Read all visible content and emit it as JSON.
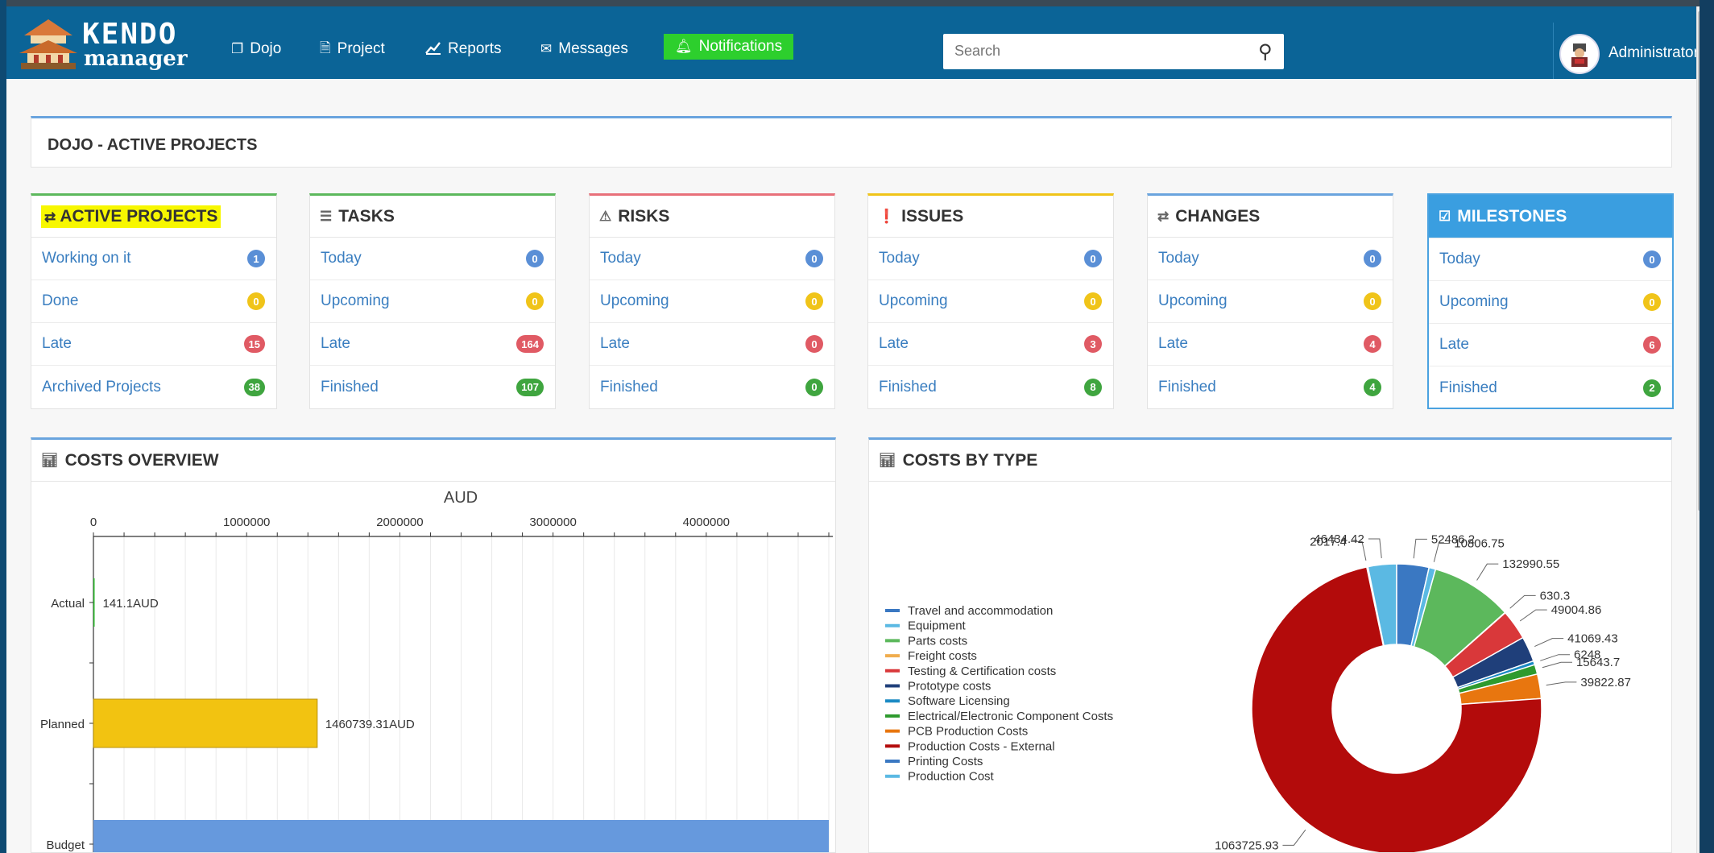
{
  "app": {
    "logo_top": "KENDO",
    "logo_bottom": "manager"
  },
  "nav": {
    "items": [
      {
        "label": "Dojo",
        "icon": "copy-icon"
      },
      {
        "label": "Project",
        "icon": "document-icon"
      },
      {
        "label": "Reports",
        "icon": "line-chart-icon"
      },
      {
        "label": "Messages",
        "icon": "envelope-icon"
      },
      {
        "label": "Notifications",
        "icon": "bell-icon"
      }
    ],
    "search_placeholder": "Search",
    "user": "Administrator"
  },
  "page_title": "DOJO - ACTIVE PROJECTS",
  "cards": [
    {
      "title": "ACTIVE PROJECTS",
      "icon": "exchange-icon",
      "rows": [
        {
          "label": "Working on it",
          "count": "1"
        },
        {
          "label": "Done",
          "count": "0"
        },
        {
          "label": "Late",
          "count": "15"
        },
        {
          "label": "Archived Projects",
          "count": "38"
        }
      ]
    },
    {
      "title": "TASKS",
      "icon": "tasks-icon",
      "rows": [
        {
          "label": "Today",
          "count": "0"
        },
        {
          "label": "Upcoming",
          "count": "0"
        },
        {
          "label": "Late",
          "count": "164"
        },
        {
          "label": "Finished",
          "count": "107"
        }
      ]
    },
    {
      "title": "RISKS",
      "icon": "warning-icon",
      "rows": [
        {
          "label": "Today",
          "count": "0"
        },
        {
          "label": "Upcoming",
          "count": "0"
        },
        {
          "label": "Late",
          "count": "0"
        },
        {
          "label": "Finished",
          "count": "0"
        }
      ]
    },
    {
      "title": "ISSUES",
      "icon": "exclamation-circle-icon",
      "rows": [
        {
          "label": "Today",
          "count": "0"
        },
        {
          "label": "Upcoming",
          "count": "0"
        },
        {
          "label": "Late",
          "count": "3"
        },
        {
          "label": "Finished",
          "count": "8"
        }
      ]
    },
    {
      "title": "CHANGES",
      "icon": "exchange-icon",
      "rows": [
        {
          "label": "Today",
          "count": "0"
        },
        {
          "label": "Upcoming",
          "count": "0"
        },
        {
          "label": "Late",
          "count": "4"
        },
        {
          "label": "Finished",
          "count": "4"
        }
      ]
    },
    {
      "title": "MILESTONES",
      "icon": "check-square-icon",
      "rows": [
        {
          "label": "Today",
          "count": "0"
        },
        {
          "label": "Upcoming",
          "count": "0"
        },
        {
          "label": "Late",
          "count": "6"
        },
        {
          "label": "Finished",
          "count": "2"
        }
      ]
    }
  ],
  "panels": {
    "costs_overview": "COSTS OVERVIEW",
    "costs_by_type": "COSTS BY TYPE"
  },
  "chart_data": [
    {
      "type": "bar",
      "orientation": "horizontal",
      "title": "AUD",
      "categories": [
        "Actual",
        "Planned",
        "Budget"
      ],
      "values": [
        141.1,
        1460739.31,
        5000000
      ],
      "data_labels": [
        "141.1AUD",
        "1460739.31AUD",
        ""
      ],
      "xlim": [
        0,
        4800000
      ],
      "xticks": [
        "0",
        "1000000",
        "2000000",
        "3000000",
        "4000000"
      ],
      "colors": [
        "#2dbd2d",
        "#f2c311",
        "#6699dd"
      ],
      "grid": true
    },
    {
      "type": "pie",
      "donut": true,
      "legend_position": "left",
      "series": [
        {
          "name": "Travel and accommodation",
          "value": 52486.2,
          "label": "52486.2",
          "color": "#3a78c2"
        },
        {
          "name": "Equipment",
          "value": 10806.75,
          "label": "10806.75",
          "color": "#5bb9e3"
        },
        {
          "name": "Parts costs",
          "value": 132990.55,
          "label": "132990.55",
          "color": "#5cb85c"
        },
        {
          "name": "Freight costs",
          "value": 630.3,
          "label": "630.3",
          "color": "#f0ad4e"
        },
        {
          "name": "Testing & Certification costs",
          "value": 49004.86,
          "label": "49004.86",
          "color": "#d9383a"
        },
        {
          "name": "Prototype costs",
          "value": 41069.43,
          "label": "41069.43",
          "color": "#1f3f7a"
        },
        {
          "name": "Software Licensing",
          "value": 6248,
          "label": "6248",
          "color": "#1b8ac4"
        },
        {
          "name": "Electrical/Electronic Component Costs",
          "value": 15643.7,
          "label": "15643.7",
          "color": "#2e9a2e"
        },
        {
          "name": "PCB Production Costs",
          "value": 39822.87,
          "label": "39822.87",
          "color": "#e8760f"
        },
        {
          "name": "Production Costs - External",
          "value": 1063725.93,
          "label": "1063725.93",
          "color": "#b30b0b"
        },
        {
          "name": "Printing Costs",
          "value": 2017.4,
          "label": "2017.4",
          "color": "#3a78c2"
        },
        {
          "name": "Production Cost",
          "value": 46434.42,
          "label": "46434.42",
          "color": "#5bb9e3"
        }
      ]
    }
  ]
}
